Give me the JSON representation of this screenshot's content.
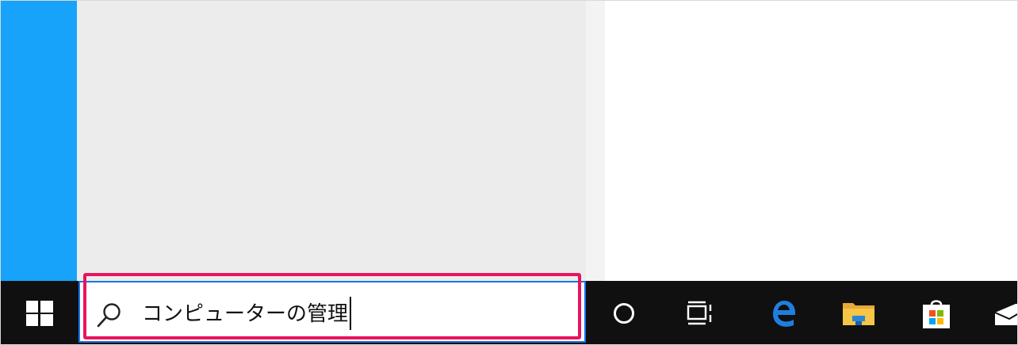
{
  "search": {
    "query": "コンピューターの管理"
  },
  "colors": {
    "start_strip": "#16a3f9",
    "panel": "#ececec",
    "taskbar": "#101010",
    "search_border": "#1a73e8",
    "highlight": "#e8145c"
  },
  "taskbar_icons": [
    {
      "name": "windows-start-icon"
    },
    {
      "name": "search-icon"
    },
    {
      "name": "cortana-icon"
    },
    {
      "name": "task-view-icon"
    },
    {
      "name": "edge-icon"
    },
    {
      "name": "file-explorer-icon"
    },
    {
      "name": "store-icon"
    },
    {
      "name": "mail-icon"
    }
  ]
}
